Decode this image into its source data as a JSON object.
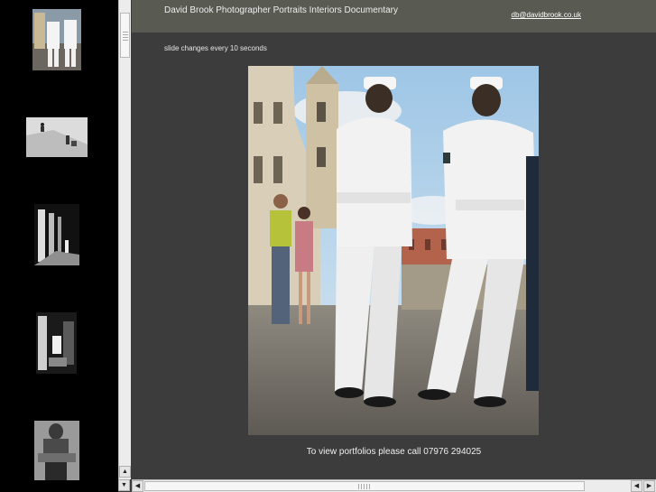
{
  "header": {
    "title": "David Brook Photographer Portraits Interiors Documentary",
    "email": "db@davidbrook.co.uk"
  },
  "slideshow": {
    "note": "slide changes every 10 seconds"
  },
  "footer": {
    "contact": "To view portfolios please call 07976 294025"
  },
  "icons": {
    "scroll_up": "arrow-up-icon",
    "scroll_down": "arrow-down-icon",
    "scroll_left": "arrow-left-icon",
    "scroll_right": "arrow-right-icon"
  },
  "colors": {
    "background": "#3c3c3c",
    "header": "#595a52",
    "thumbnail_strip": "#000000"
  }
}
